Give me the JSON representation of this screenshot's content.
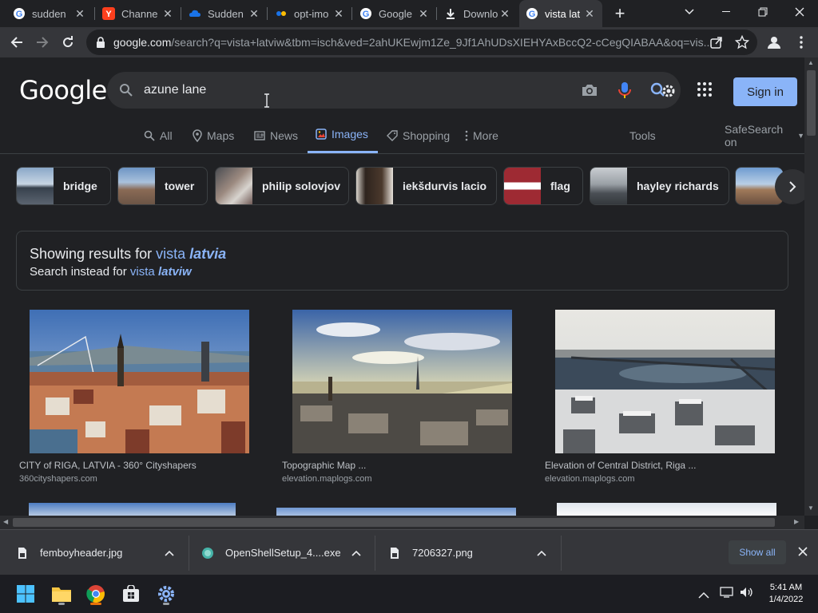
{
  "tabs": [
    {
      "title": "sudden",
      "icon": "google-icon"
    },
    {
      "title": "Channe",
      "icon": "yandex-icon"
    },
    {
      "title": "Sudden",
      "icon": "cloud-icon"
    },
    {
      "title": "opt-imo",
      "icon": "dots-icon"
    },
    {
      "title": "Google",
      "icon": "google-icon"
    },
    {
      "title": "Downlo",
      "icon": "download-icon"
    },
    {
      "title": "vista lat",
      "icon": "google-icon",
      "active": true
    }
  ],
  "address": {
    "host": "google.com",
    "rest": "/search?q=vista+latviw&tbm=isch&ved=2ahUKEwjm1Ze_9Jf1AhUDsXIEHYAxBccQ2-cCegQIABAA&oq=vis..."
  },
  "logo": "Google",
  "search": {
    "value": "azune lane "
  },
  "signin_label": "Sign in",
  "navtabs": [
    {
      "label": "All",
      "icon": "search-icon"
    },
    {
      "label": "Maps",
      "icon": "pin-icon"
    },
    {
      "label": "News",
      "icon": "news-icon"
    },
    {
      "label": "Images",
      "icon": "image-icon",
      "active": true
    },
    {
      "label": "Shopping",
      "icon": "tag-icon"
    },
    {
      "label": "More",
      "icon": "more-vert-icon"
    }
  ],
  "tools_label": "Tools",
  "safesearch_label": "SafeSearch on",
  "chips": [
    "bridge",
    "tower",
    "philip solovjov",
    "iekšdurvis lacio",
    "flag",
    "hayley richards"
  ],
  "correction": {
    "showing_prefix": "Showing results for",
    "showing_word": "vista",
    "showing_italic": "latvia",
    "instead_prefix": "Search instead for",
    "instead_word": "vista",
    "instead_italic": "latviw"
  },
  "results": [
    {
      "title": "CITY of RIGA, LATVIA - 360° Cityshapers",
      "source": "360cityshapers.com"
    },
    {
      "title": "Topographic Map ...",
      "source": "elevation.maplogs.com"
    },
    {
      "title": "Elevation of Central District, Riga ...",
      "source": "elevation.maplogs.com"
    }
  ],
  "downloads": [
    {
      "name": "femboyheader.jpg",
      "icon": "file-icon"
    },
    {
      "name": "OpenShellSetup_4....exe",
      "icon": "shell-icon"
    },
    {
      "name": "7206327.png",
      "icon": "file-icon"
    }
  ],
  "show_all_label": "Show all",
  "clock": {
    "time": "5:41 AM",
    "date": "1/4/2022"
  },
  "colors": {
    "accent": "#8ab4f8",
    "bg": "#202124",
    "flag_red": "#9e2a33"
  }
}
